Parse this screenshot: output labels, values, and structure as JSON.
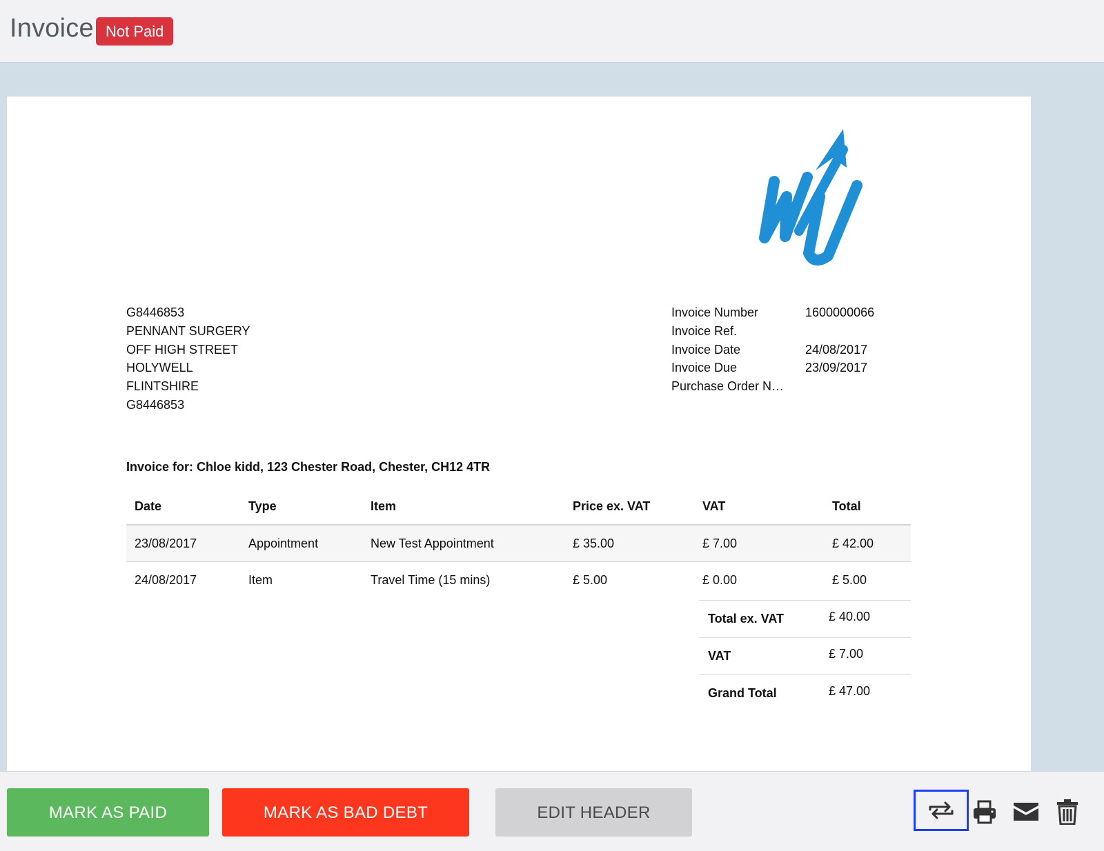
{
  "header": {
    "title": "Invoice",
    "status_badge": "Not Paid"
  },
  "billing_address": {
    "lines": [
      "G8446853",
      "PENNANT SURGERY",
      "OFF HIGH STREET",
      "HOLYWELL",
      "FLINTSHIRE",
      "G8446853"
    ]
  },
  "invoice_meta": [
    {
      "label": "Invoice Number",
      "value": "1600000066"
    },
    {
      "label": "Invoice Ref.",
      "value": ""
    },
    {
      "label": "Invoice Date",
      "value": "24/08/2017"
    },
    {
      "label": "Invoice Due",
      "value": "23/09/2017"
    },
    {
      "label": "Purchase Order N…",
      "value": ""
    }
  ],
  "invoice_for": "Invoice for: Chloe kidd, 123 Chester Road, Chester, CH12 4TR",
  "table": {
    "columns": [
      "Date",
      "Type",
      "Item",
      "Price ex. VAT",
      "VAT",
      "Total"
    ],
    "rows": [
      [
        "23/08/2017",
        "Appointment",
        "New Test Appointment",
        "£ 35.00",
        "£ 7.00",
        "£ 42.00"
      ],
      [
        "24/08/2017",
        "Item",
        "Travel Time (15 mins)",
        "£ 5.00",
        "£ 0.00",
        "£ 5.00"
      ]
    ]
  },
  "totals": [
    {
      "label": "Total ex. VAT",
      "value": "£ 40.00"
    },
    {
      "label": "VAT",
      "value": "£ 7.00"
    },
    {
      "label": "Grand Total",
      "value": "£ 47.00"
    }
  ],
  "footer": {
    "mark_paid": "MARK AS PAID",
    "mark_bad_debt": "MARK AS BAD DEBT",
    "edit_header": "EDIT HEADER",
    "icons": [
      "convert-icon",
      "print-icon",
      "email-icon",
      "trash-icon"
    ]
  },
  "colors": {
    "badge": "#d9343d",
    "paid_button": "#5cb85c",
    "bad_debt_button": "#fd371e",
    "edit_button": "#d2d2d4",
    "logo_blue": "#1f8fd6",
    "highlight_border": "#1a3ff5"
  }
}
